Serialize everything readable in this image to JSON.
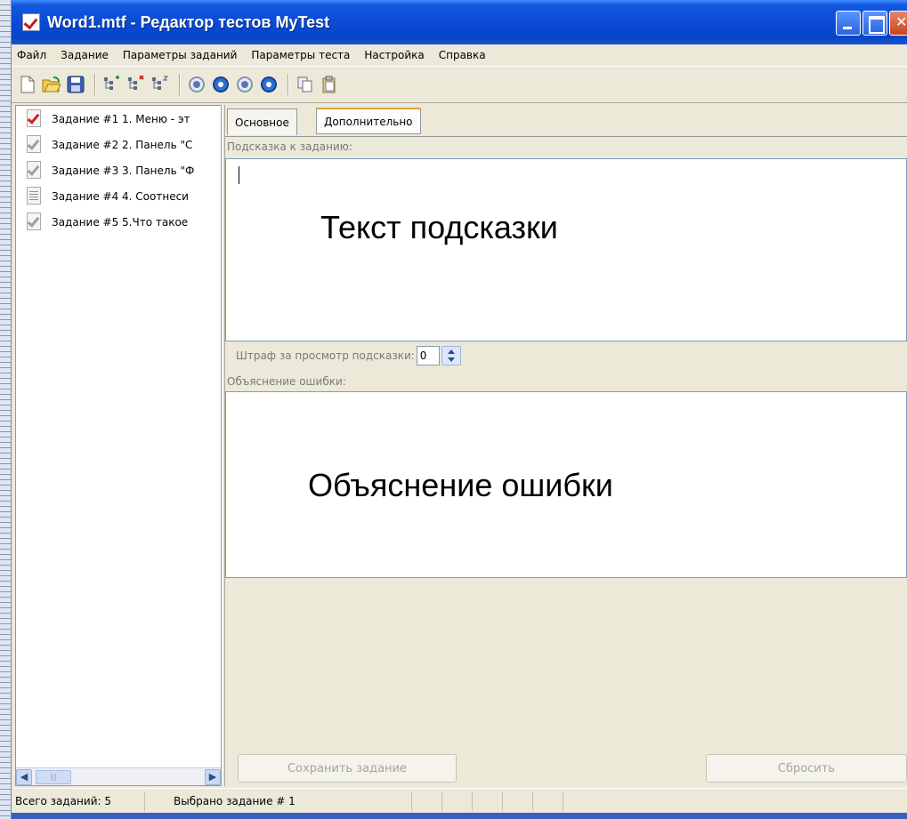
{
  "window": {
    "title": "Word1.mtf - Редактор тестов MyTest"
  },
  "menu": [
    {
      "label": "Файл"
    },
    {
      "label": "Задание"
    },
    {
      "label": "Параметры заданий"
    },
    {
      "label": "Параметры теста"
    },
    {
      "label": "Настройка"
    },
    {
      "label": "Справка"
    }
  ],
  "toolbar": {
    "icons": [
      "new-file-icon",
      "open-folder-icon",
      "save-icon",
      "add-task-icon",
      "delete-task-icon",
      "task-settings-icon",
      "first-icon",
      "down-icon",
      "up-icon",
      "help-icon",
      "copy-icon",
      "paste-icon"
    ]
  },
  "tasks": [
    {
      "label": "Задание #1 1. Меню - эт",
      "type": "check",
      "selected": true
    },
    {
      "label": "Задание #2 2. Панель \"С",
      "type": "check",
      "selected": false
    },
    {
      "label": "Задание #3 3. Панель \"Ф",
      "type": "check",
      "selected": false
    },
    {
      "label": "Задание #4 4. Соотнеси",
      "type": "list",
      "selected": false
    },
    {
      "label": "Задание #5 5.Что такое",
      "type": "check",
      "selected": false
    }
  ],
  "tabs": {
    "main": "Основное",
    "extra": "Дополнительно"
  },
  "hint": {
    "label": "Подсказка к заданию:",
    "overlay_text": "Текст подсказки"
  },
  "penalty": {
    "label": "Штраф за просмотр подсказки:",
    "value": "0"
  },
  "explanation": {
    "label": "Объяснение ошибки:",
    "overlay_text": "Объяснение ошибки"
  },
  "buttons": {
    "save": "Сохранить задание",
    "reset": "Сбросить"
  },
  "status": {
    "total": "Всего заданий: 5",
    "selected": "Выбрано задание # 1"
  }
}
